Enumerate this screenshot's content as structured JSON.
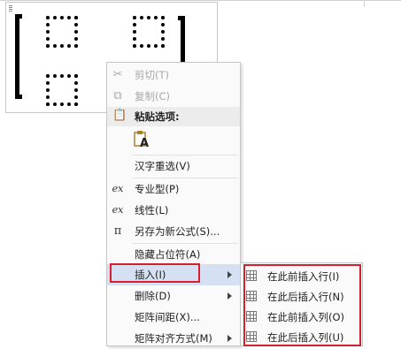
{
  "context_menu": {
    "items": [
      {
        "label": "剪切(T)",
        "icon": "cut-icon",
        "enabled": false
      },
      {
        "label": "复制(C)",
        "icon": "copy-icon",
        "enabled": false
      },
      {
        "label": "粘贴选项:",
        "icon": "paste-icon",
        "enabled": true
      },
      {
        "label": "汉字重选(V)",
        "icon": "",
        "enabled": true
      },
      {
        "label": "专业型(P)",
        "icon": "equation-professional-icon",
        "enabled": true
      },
      {
        "label": "线性(L)",
        "icon": "equation-linear-icon",
        "enabled": true
      },
      {
        "label": "另存为新公式(S)...",
        "icon": "save-equation-icon",
        "enabled": true
      },
      {
        "label": "隐藏占位符(A)",
        "icon": "",
        "enabled": true
      },
      {
        "label": "插入(I)",
        "icon": "",
        "enabled": true,
        "highlighted": true,
        "has_submenu": true
      },
      {
        "label": "删除(D)",
        "icon": "",
        "enabled": true,
        "has_submenu": true
      },
      {
        "label": "矩阵间距(X)...",
        "icon": "",
        "enabled": true
      },
      {
        "label": "矩阵对齐方式(M)",
        "icon": "",
        "enabled": true,
        "has_submenu": true
      }
    ],
    "paste_option_letter": "A"
  },
  "insert_submenu": {
    "items": [
      {
        "label": "在此前插入行(I)",
        "icon": "insert-row-above-icon"
      },
      {
        "label": "在此后插入行(N)",
        "icon": "insert-row-below-icon"
      },
      {
        "label": "在此前插入列(O)",
        "icon": "insert-column-left-icon"
      },
      {
        "label": "在此后插入列(U)",
        "icon": "insert-column-right-icon"
      }
    ]
  },
  "colors": {
    "highlight_box": "#d81e2c",
    "menu_hover": "#d5e1f2",
    "menu_background": "#fafafa"
  }
}
